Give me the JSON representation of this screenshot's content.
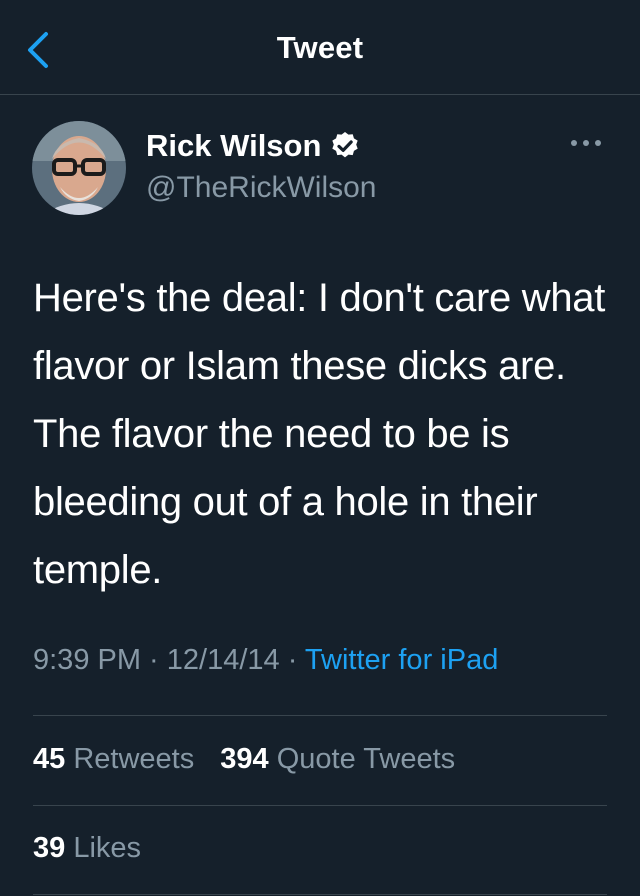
{
  "header": {
    "title": "Tweet",
    "back_icon": "chevron-left-icon"
  },
  "author": {
    "name": "Rick Wilson",
    "handle": "@TheRickWilson",
    "verified": true
  },
  "tweet": {
    "text": "Here's the deal: I don't care what flavor or Islam these dicks are. The flavor the need to be is bleeding out of a hole in their temple.",
    "time": "9:39 PM",
    "date": "12/14/14",
    "separator": " · ",
    "source": "Twitter for iPad"
  },
  "stats": {
    "retweets_count": "45",
    "retweets_label": "Retweets",
    "quote_count": "394",
    "quote_label": "Quote Tweets",
    "likes_count": "39",
    "likes_label": "Likes"
  },
  "colors": {
    "background": "#15202b",
    "accent": "#1da1f2",
    "secondary_text": "#8899a6",
    "divider": "#38444d"
  }
}
